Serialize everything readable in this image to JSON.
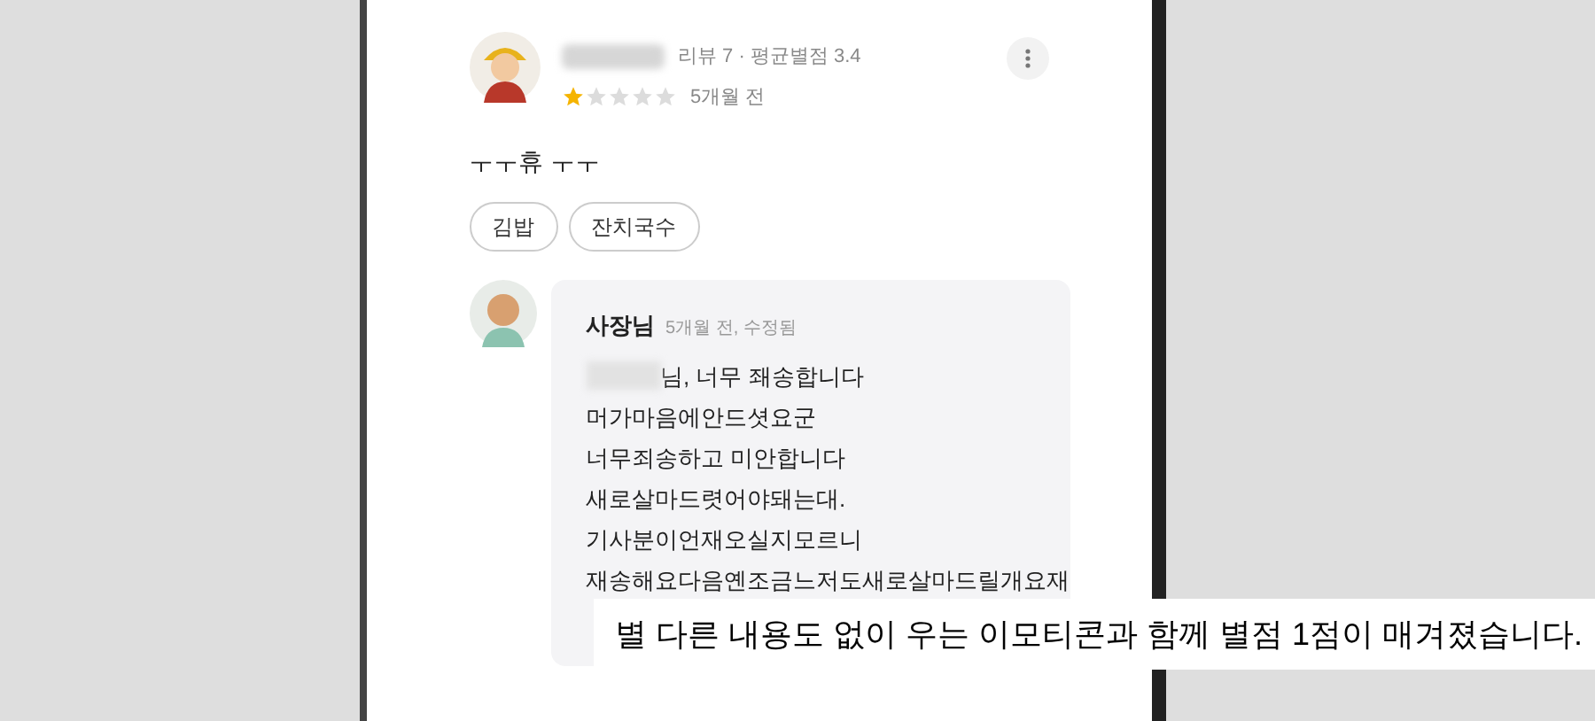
{
  "review": {
    "meta": "리뷰 7 · 평균별점 3.4",
    "stars": 1,
    "time": "5개월 전",
    "text": "ㅜㅜ휴 ㅜㅜ",
    "tags": [
      "김밥",
      "잔치국수"
    ]
  },
  "reply": {
    "author": "사장님",
    "time": "5개월 전, 수정됨",
    "lines": [
      "님, 너무 좨송합니다",
      "머가마음에안드셧요군",
      "너무죄송하고 미안합니다",
      "새로살마드렷어야돼는대.",
      "기사분이언재오실지모르니",
      "재송해요다음옌조금느저도새로살마드릴개요재"
    ]
  },
  "caption": "별 다른 내용도 없이 우는 이모티콘과 함께 별점 1점이 매겨졌습니다."
}
